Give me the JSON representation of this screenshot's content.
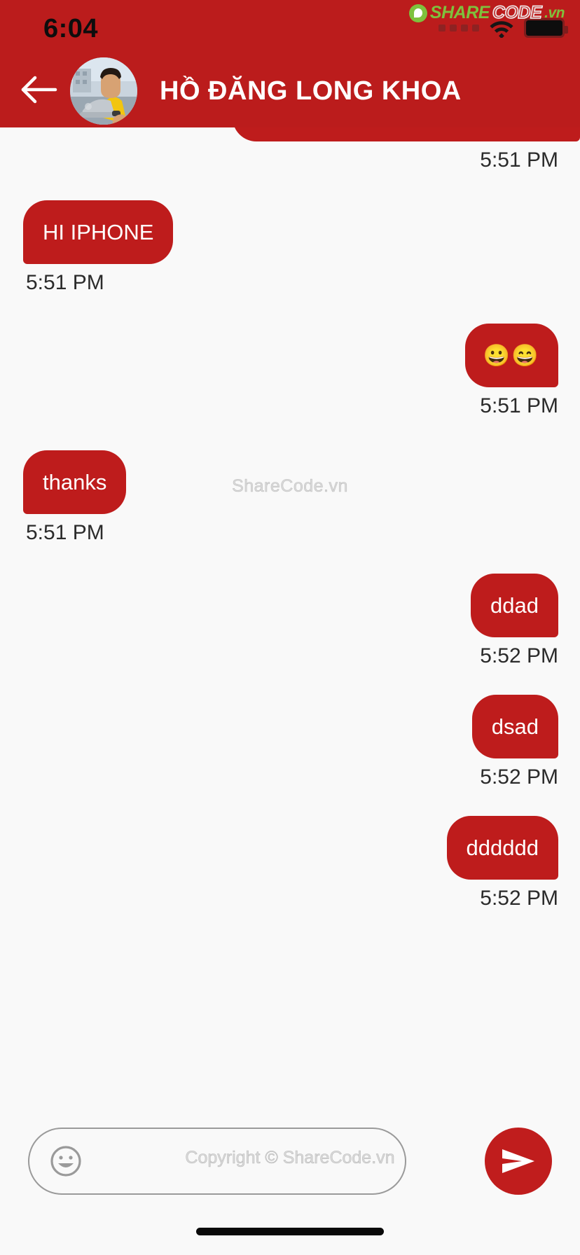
{
  "status_bar": {
    "time": "6:04",
    "signal_icon": "signal-dots-icon",
    "wifi_icon": "wifi-icon",
    "battery_icon": "battery-full-icon"
  },
  "watermark": {
    "logo_mark": "sharecode-logo-icon",
    "logo_part1": "SHARE",
    "logo_part2": "CODE",
    "logo_part3": ".vn",
    "center_text": "ShareCode.vn",
    "bottom_text": "Copyright © ShareCode.vn"
  },
  "header": {
    "back_icon": "back-arrow-icon",
    "avatar": "contact-avatar",
    "title": "HỒ ĐĂNG LONG KHOA",
    "background_color": "#bb1c1c"
  },
  "chat": {
    "background_color": "#f9f9f9",
    "bubble_color": "#be1c1c",
    "bubble_text_color": "#ffffff",
    "clipped_message": {
      "time": "5:51 PM",
      "side": "right"
    },
    "messages": [
      {
        "text": "HI IPHONE",
        "time": "5:51 PM",
        "side": "left"
      },
      {
        "text": "😀😄",
        "time": "5:51 PM",
        "side": "right"
      },
      {
        "text": "thanks",
        "time": "5:51 PM",
        "side": "left"
      },
      {
        "text": "ddad",
        "time": "5:52 PM",
        "side": "right"
      },
      {
        "text": "dsad",
        "time": "5:52 PM",
        "side": "right"
      },
      {
        "text": "dddddd",
        "time": "5:52 PM",
        "side": "right"
      }
    ]
  },
  "input_bar": {
    "emoji_icon": "emoji-smiley-icon",
    "placeholder": "",
    "value": "",
    "send_icon": "send-icon",
    "send_button_color": "#c01d1d"
  },
  "system": {
    "home_indicator": "home-indicator"
  }
}
